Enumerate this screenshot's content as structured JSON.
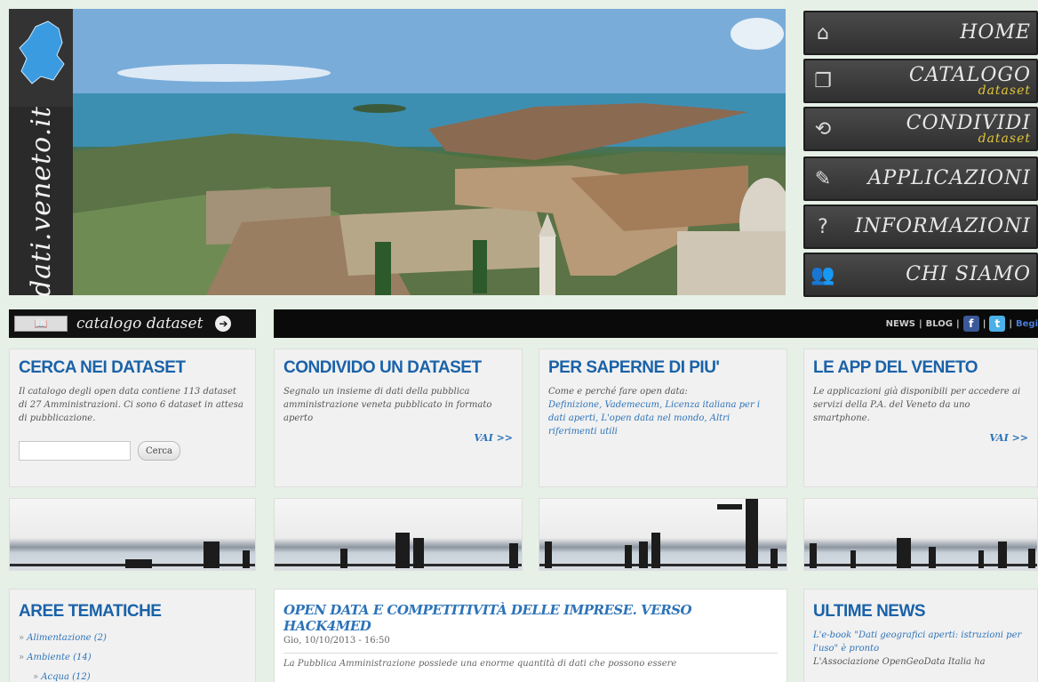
{
  "site": {
    "logo_text": "dati.veneto.it"
  },
  "nav": {
    "items": [
      {
        "label": "HOME",
        "sub": "",
        "icon": "home-icon",
        "glyph": "⌂"
      },
      {
        "label": "CATALOGO",
        "sub": "dataset",
        "icon": "copy-icon",
        "glyph": "❐"
      },
      {
        "label": "CONDIVIDI",
        "sub": "dataset",
        "icon": "share-icon",
        "glyph": "⟲"
      },
      {
        "label": "APPLICAZIONI",
        "sub": "",
        "icon": "phone-icon",
        "glyph": "✎"
      },
      {
        "label": "INFORMAZIONI",
        "sub": "",
        "icon": "question-icon",
        "glyph": "?"
      },
      {
        "label": "CHI SIAMO",
        "sub": "",
        "icon": "people-icon",
        "glyph": "👥"
      }
    ]
  },
  "catalog_bar": {
    "label": "catalogo dataset",
    "book_label": "📖",
    "arrow": "➔"
  },
  "top_bar": {
    "news": "NEWS",
    "sep1": "|",
    "blog": "BLOG",
    "sep2": "|",
    "fb": "f",
    "sep3": "|",
    "tw": "t",
    "sep4": "|",
    "last": "Begi"
  },
  "cards": {
    "search": {
      "title": "CERCA NEI DATASET",
      "text": "Il catalogo degli open data contiene 113 dataset di 27 Amministrazioni. Ci sono 6 dataset in attesa di pubblicazione.",
      "button": "Cerca",
      "input_value": ""
    },
    "share": {
      "title": "CONDIVIDO UN DATASET",
      "text": "Segnalo un insieme di dati della pubblica amministrazione veneta pubblicato in formato aperto",
      "vai": "VAI >>"
    },
    "learn": {
      "title": "PER SAPERNE DI PIU'",
      "intro": "Come e perché fare open data:",
      "links": "Definizione, Vademecum, Licenza italiana per i dati aperti, L'open data nel mondo, Altri riferimenti utili"
    },
    "apps": {
      "title": "LE APP DEL VENETO",
      "text": "Le applicazioni già disponibili per accedere ai servizi della P.A. del Veneto da uno smartphone.",
      "vai": "VAI >>"
    }
  },
  "bottom": {
    "themes": {
      "title": "AREE TEMATICHE",
      "items": [
        "Alimentazione (2)",
        "Ambiente (14)",
        "Acqua (12)"
      ]
    },
    "article": {
      "title": "OPEN DATA E COMPETITIVITÀ DELLE IMPRESE. VERSO HACK4MED",
      "date": "Gio, 10/10/2013 - 16:50",
      "excerpt": "La Pubblica Amministrazione possiede una enorme quantità di dati che possono essere"
    },
    "news": {
      "title": "ULTIME NEWS",
      "item1": "L'e-book \"Dati geografici aperti: istruzioni per l'uso\" è pronto",
      "item2": "L'Associazione OpenGeoData Italia ha"
    }
  }
}
